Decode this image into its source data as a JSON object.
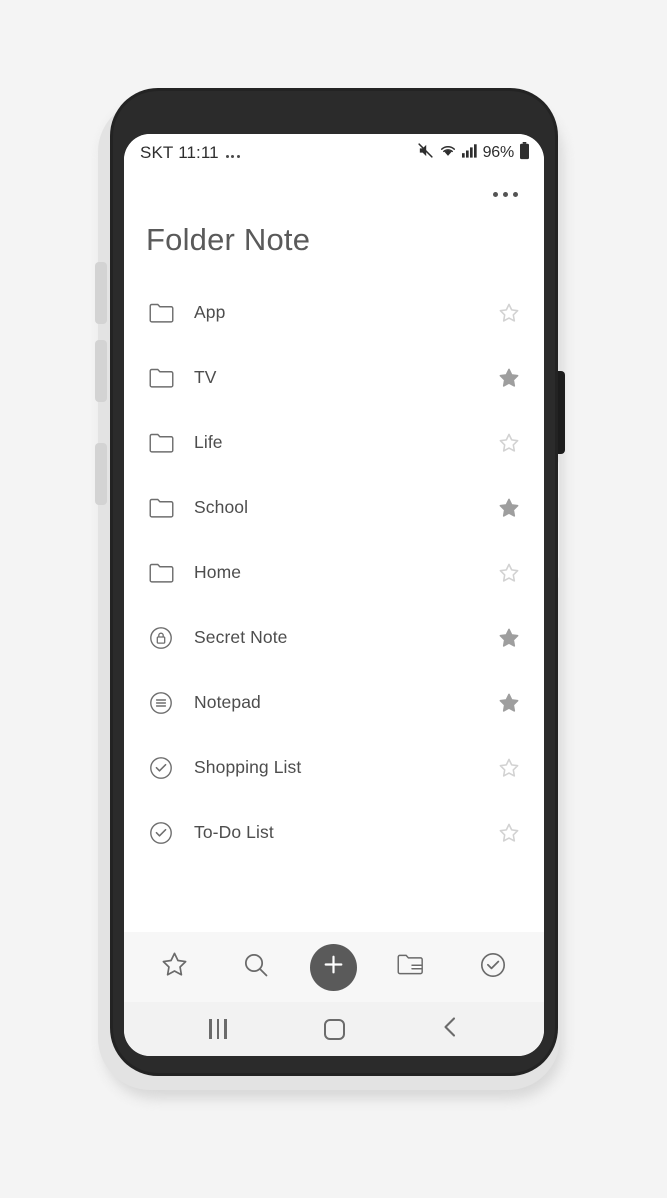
{
  "device": {
    "name": "samsung-galaxy-phone",
    "frame_color": "#232323",
    "body_color": "#2b2b2b"
  },
  "status_bar": {
    "carrier": "SKT",
    "time": "11:11",
    "overflow_dots": "···",
    "icons": [
      "mute-icon",
      "wifi-icon",
      "signal-icon"
    ],
    "battery_percent": "96%",
    "battery_icon": "battery-full-icon"
  },
  "app": {
    "title": "Folder Note",
    "overflow_menu": "more-options-icon",
    "text_color": "#5a5a5a"
  },
  "list": {
    "items": [
      {
        "label": "App",
        "icon": "folder-icon",
        "starred": false
      },
      {
        "label": "TV",
        "icon": "folder-icon",
        "starred": true
      },
      {
        "label": "Life",
        "icon": "folder-icon",
        "starred": false
      },
      {
        "label": "School",
        "icon": "folder-icon",
        "starred": true
      },
      {
        "label": "Home",
        "icon": "folder-icon",
        "starred": false
      },
      {
        "label": "Secret Note",
        "icon": "lock-circle-icon",
        "starred": true
      },
      {
        "label": "Notepad",
        "icon": "lines-circle-icon",
        "starred": true
      },
      {
        "label": "Shopping List",
        "icon": "check-circle-icon",
        "starred": false
      },
      {
        "label": "To-Do List",
        "icon": "check-circle-icon",
        "starred": false
      }
    ]
  },
  "toolbar": {
    "favorites_label": "Favorites",
    "search_label": "Search",
    "add_label": "Add",
    "folders_label": "Folders",
    "tasks_label": "Tasks",
    "fab_color": "#5a5a5a",
    "background": "#f7f7f7"
  },
  "navbar": {
    "recents_label": "Recents",
    "home_label": "Home",
    "back_label": "Back"
  },
  "colors": {
    "page_background": "#f4f4f4",
    "screen_background": "#ffffff",
    "star_filled": "#9e9e9e",
    "star_outline": "#d2d2d2",
    "icon": "#6e6e6e"
  }
}
